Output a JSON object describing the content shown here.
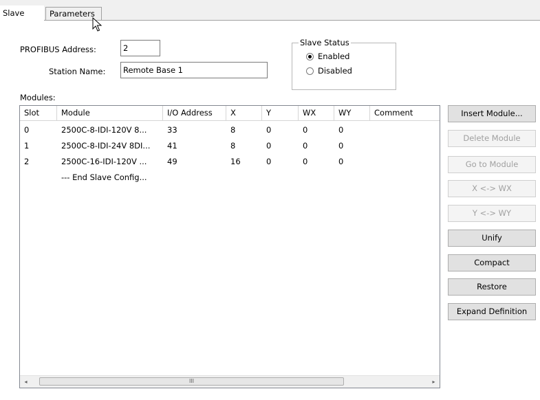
{
  "tabs": [
    {
      "label": "Slave"
    },
    {
      "label": "Parameters"
    }
  ],
  "profibus_address": {
    "label": "PROFIBUS Address:",
    "value": "2"
  },
  "station_name": {
    "label": "Station Name:",
    "value": "Remote Base 1"
  },
  "slave_status": {
    "title": "Slave Status",
    "options": [
      {
        "label": "Enabled",
        "selected": true
      },
      {
        "label": "Disabled",
        "selected": false
      }
    ]
  },
  "modules_label": "Modules:",
  "columns": [
    "Slot",
    "Module",
    "I/O Address",
    "X",
    "Y",
    "WX",
    "WY",
    "Comment"
  ],
  "rows": [
    {
      "slot": "0",
      "module": "2500C-8-IDI-120V 8...",
      "io": "33",
      "x": "8",
      "y": "0",
      "wx": "0",
      "wy": "0",
      "comment": ""
    },
    {
      "slot": "1",
      "module": "2500C-8-IDI-24V 8DI...",
      "io": "41",
      "x": "8",
      "y": "0",
      "wx": "0",
      "wy": "0",
      "comment": ""
    },
    {
      "slot": "2",
      "module": "2500C-16-IDI-120V ...",
      "io": "49",
      "x": "16",
      "y": "0",
      "wx": "0",
      "wy": "0",
      "comment": ""
    },
    {
      "slot": "",
      "module": "--- End Slave Config...",
      "io": "",
      "x": "",
      "y": "",
      "wx": "",
      "wy": "",
      "comment": ""
    }
  ],
  "scrollbar": {
    "left_arrow": "◂",
    "right_arrow": "▸",
    "grip": "III"
  },
  "buttons": [
    {
      "label": "Insert Module...",
      "enabled": true
    },
    {
      "label": "Delete Module",
      "enabled": false
    },
    {
      "label": "Go to Module",
      "enabled": false
    },
    {
      "label": "X <-> WX",
      "enabled": false
    },
    {
      "label": "Y <-> WY",
      "enabled": false
    },
    {
      "label": "Unify",
      "enabled": true
    },
    {
      "label": "Compact",
      "enabled": true
    },
    {
      "label": "Restore",
      "enabled": true
    },
    {
      "label": "Expand Definition",
      "enabled": true
    }
  ]
}
